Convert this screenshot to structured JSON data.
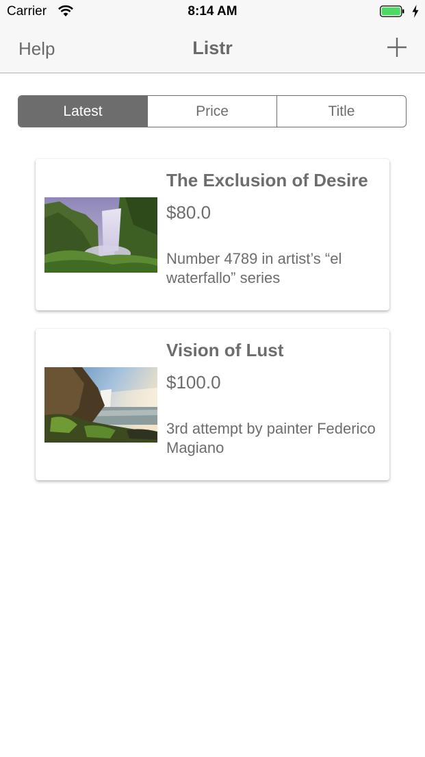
{
  "status_bar": {
    "carrier": "Carrier",
    "time": "8:14 AM",
    "battery_color": "#4cd964"
  },
  "nav": {
    "help_label": "Help",
    "title": "Listr",
    "add_icon": "plus-icon"
  },
  "sort_control": {
    "segments": [
      "Latest",
      "Price",
      "Title"
    ],
    "selected": "Latest"
  },
  "listings": [
    {
      "title": "The Exclusion of Desire",
      "price": "$80.0",
      "description": "Number 4789 in artist’s “el waterfallo” series",
      "image": "waterfall-photo"
    },
    {
      "title": "Vision of Lust",
      "price": "$100.0",
      "description": "3rd attempt by painter Federico Magiano",
      "image": "waterfall-coast-photo"
    }
  ],
  "colors": {
    "accent_gray": "#6d6d6d",
    "bar_background": "#f7f7f7"
  }
}
